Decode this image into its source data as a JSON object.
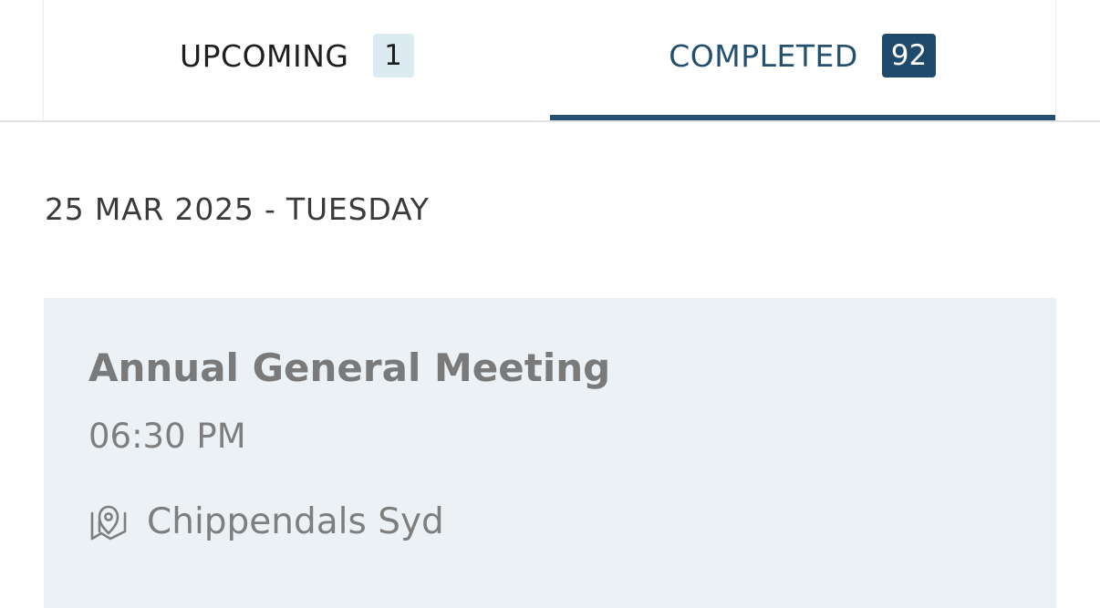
{
  "tabs": [
    {
      "label": "UPCOMING",
      "count": "1",
      "active": false
    },
    {
      "label": "COMPLETED",
      "count": "92",
      "active": true
    }
  ],
  "date_heading": "25 MAR 2025 - TUESDAY",
  "event": {
    "title": "Annual General Meeting",
    "time": "06:30 PM",
    "location_icon": "map-pin-icon",
    "location": "Chippendals Syd"
  },
  "colors": {
    "accent": "#23506f",
    "badge_active_bg": "#204a6b",
    "badge_inactive_bg": "#dceaf2",
    "card_bg": "#ebf1f5",
    "muted_text": "#7a7a7a"
  }
}
